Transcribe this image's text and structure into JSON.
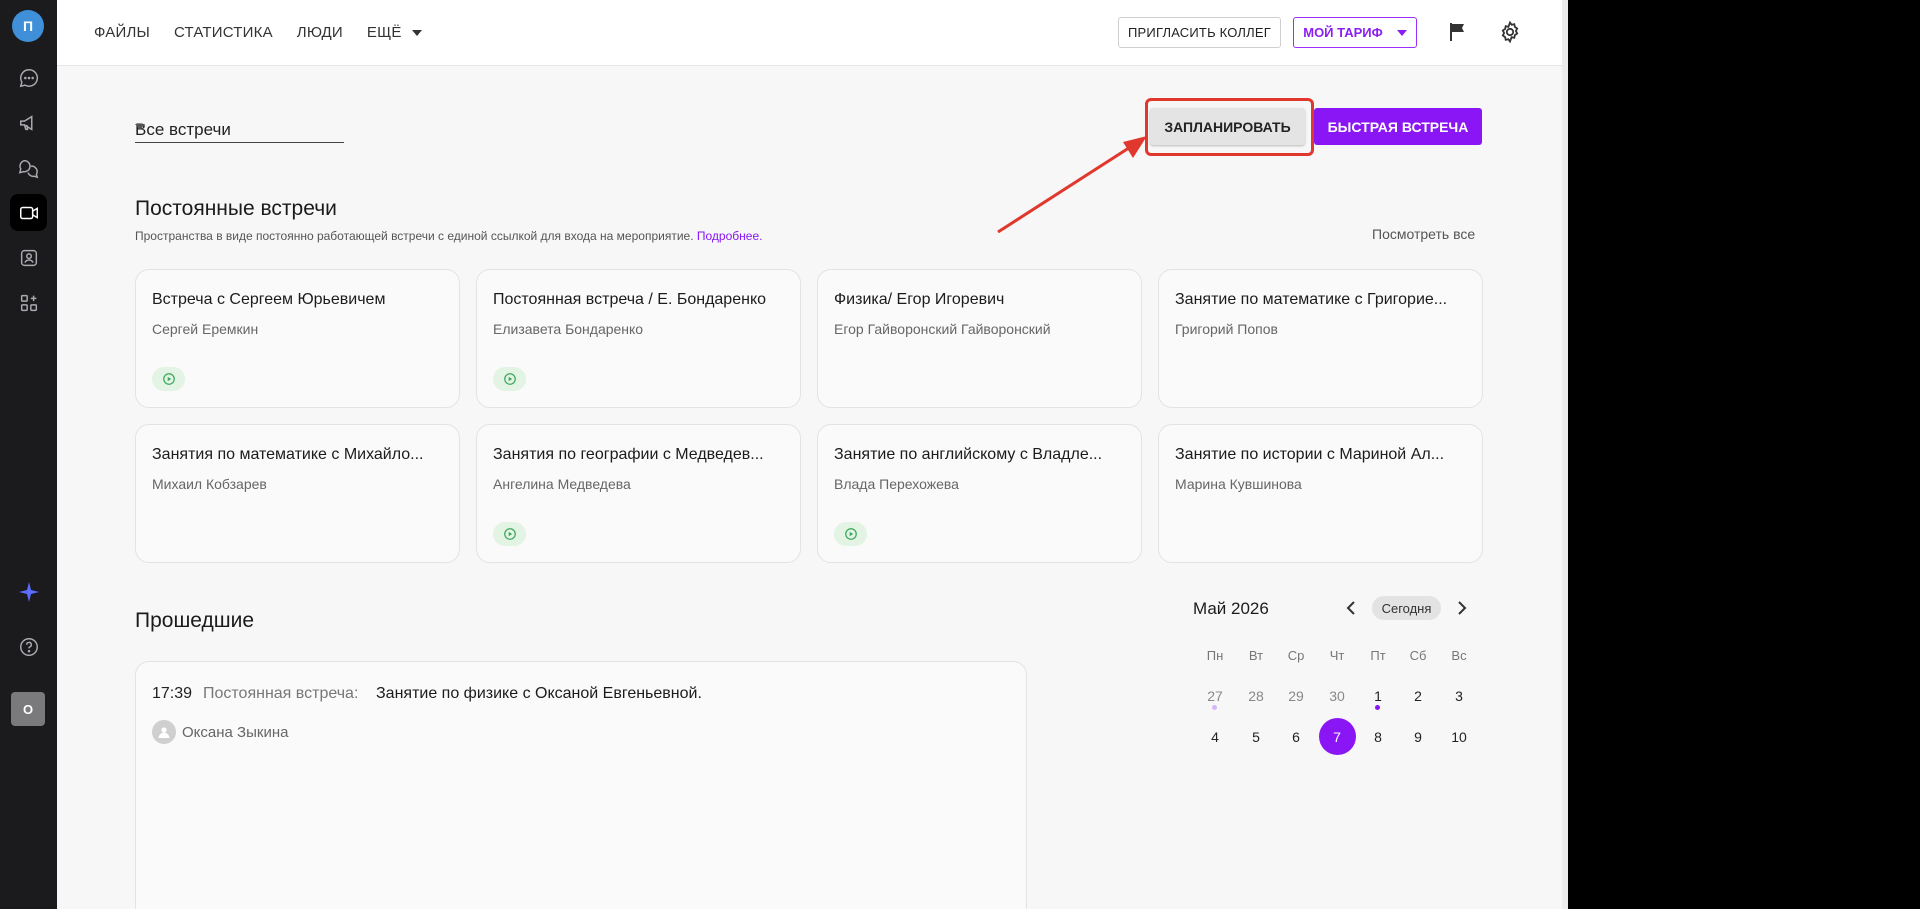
{
  "rail": {
    "avatar_letter": "П",
    "me_letter": "О",
    "items": [
      "chat-icon",
      "megaphone-icon",
      "comments-icon",
      "video-icon",
      "contact-icon",
      "apps-icon"
    ],
    "assistant": "sparkle-icon",
    "help": "help-icon"
  },
  "topbar": {
    "nav": [
      "ФАЙЛЫ",
      "СТАТИСТИКА",
      "ЛЮДИ",
      "ЕЩЁ"
    ],
    "invite_label": "ПРИГЛАСИТЬ КОЛЛЕГ",
    "tariff_label": "МОЙ ТАРИФ"
  },
  "filter": {
    "selected": "Все встречи"
  },
  "actions": {
    "plan_label": "ЗАПЛАНИРОВАТЬ",
    "quick_label": "БЫСТРАЯ ВСТРЕЧА"
  },
  "permanent": {
    "title": "Постоянные встречи",
    "subtitle": "Пространства в виде постоянно работающей встречи с единой ссылкой для входа на мероприятие.",
    "more_link": "Подробнее.",
    "see_all": "Посмотреть все",
    "cards": [
      {
        "title": "Встреча с Сергеем Юрьевичем",
        "owner": "Сергей Еремкин",
        "live": true
      },
      {
        "title": "Постоянная встреча / Е. Бондаренко",
        "owner": "Елизавета Бондаренко",
        "live": true
      },
      {
        "title": "Физика/ Егор Игоревич",
        "owner": "Егор Гайворонский Гайворонский",
        "live": false
      },
      {
        "title": "Занятие по математике с Григорие...",
        "owner": "Григорий Попов",
        "live": false
      },
      {
        "title": "Занятия по математике с Михайло...",
        "owner": "Михаил Кобзарев",
        "live": false
      },
      {
        "title": "Занятия по географии с Медведев...",
        "owner": "Ангелина Медведева",
        "live": true
      },
      {
        "title": "Занятие по английскому с Владле...",
        "owner": "Влада Перехожева",
        "live": true
      },
      {
        "title": "Занятие по истории с Мариной Ал...",
        "owner": "Марина Кувшинова",
        "live": false
      }
    ]
  },
  "past": {
    "title": "Прошедшие",
    "items": [
      {
        "time": "17:39",
        "kind": "Постоянная встреча:",
        "name": "Занятие по физике с Оксаной Евгеньевной.",
        "person": "Оксана Зыкина"
      }
    ]
  },
  "calendar": {
    "month": "Май 2026",
    "today_label": "Сегодня",
    "weekdays": [
      "Пн",
      "Вт",
      "Ср",
      "Чт",
      "Пт",
      "Сб",
      "Вс"
    ],
    "row1": [
      "27",
      "28",
      "29",
      "30",
      "1",
      "2",
      "3"
    ],
    "row2": [
      "4",
      "5",
      "6",
      "7",
      "8",
      "9",
      "10"
    ],
    "selected_day": "7",
    "accent": "#8a16f5"
  }
}
